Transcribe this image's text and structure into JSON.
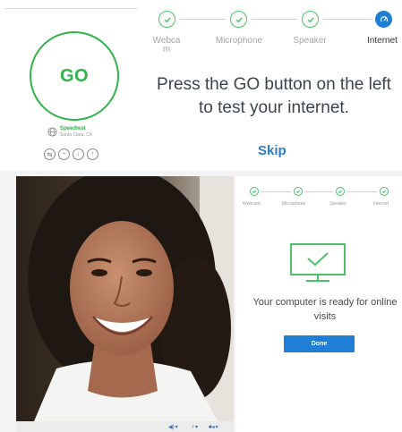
{
  "speedtest": {
    "go_label": "GO",
    "server_name": "Speedtest",
    "server_location": "Santa Clara, CA",
    "icons": [
      "sync-icon",
      "tilde-icon",
      "download-icon",
      "upload-icon"
    ]
  },
  "steps": [
    {
      "label": "Webcam",
      "state": "done"
    },
    {
      "label": "Microphone",
      "state": "done"
    },
    {
      "label": "Speaker",
      "state": "done"
    },
    {
      "label": "Internet",
      "state": "active"
    }
  ],
  "prompt": "Press the GO button on the left to test your internet.",
  "skip_label": "Skip",
  "colors": {
    "green": "#2fb34a",
    "blue": "#1f7fd6",
    "link": "#2b7ec9"
  },
  "ready_card": {
    "steps": [
      "Webcam",
      "Microphone",
      "Speaker",
      "Internet"
    ],
    "message": "Your computer is ready for online visits",
    "done_label": "Done"
  }
}
